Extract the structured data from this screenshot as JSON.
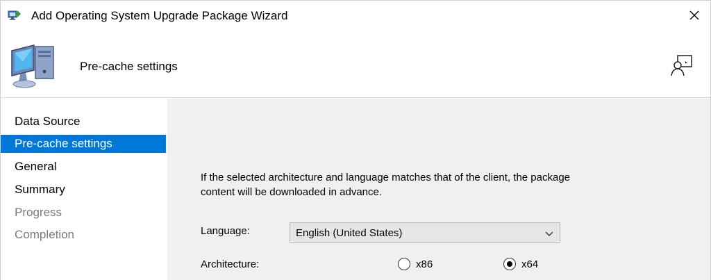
{
  "window": {
    "title": "Add Operating System Upgrade Package Wizard",
    "close_glyph": "✕"
  },
  "header": {
    "title": "Pre-cache settings"
  },
  "nav": {
    "items": [
      {
        "label": "Data Source",
        "state": "normal"
      },
      {
        "label": "Pre-cache settings",
        "state": "active"
      },
      {
        "label": "General",
        "state": "normal"
      },
      {
        "label": "Summary",
        "state": "normal"
      },
      {
        "label": "Progress",
        "state": "disabled"
      },
      {
        "label": "Completion",
        "state": "disabled"
      }
    ]
  },
  "content": {
    "description_line1": "If the selected architecture and language matches that of the client, the package",
    "description_line2": "content will be downloaded in advance.",
    "language_label": "Language:",
    "language_value": "English (United States)",
    "architecture_label": "Architecture:",
    "arch_options": [
      {
        "label": "x86",
        "checked": false
      },
      {
        "label": "x64",
        "checked": true
      }
    ]
  },
  "colors": {
    "accent": "#0078d7",
    "content_bg": "#f0f0f0",
    "disabled_text": "#7a7a7a"
  },
  "icons": [
    "app-wizard-icon",
    "close-icon",
    "computer-icon",
    "help-icon",
    "chevron-down-icon"
  ]
}
